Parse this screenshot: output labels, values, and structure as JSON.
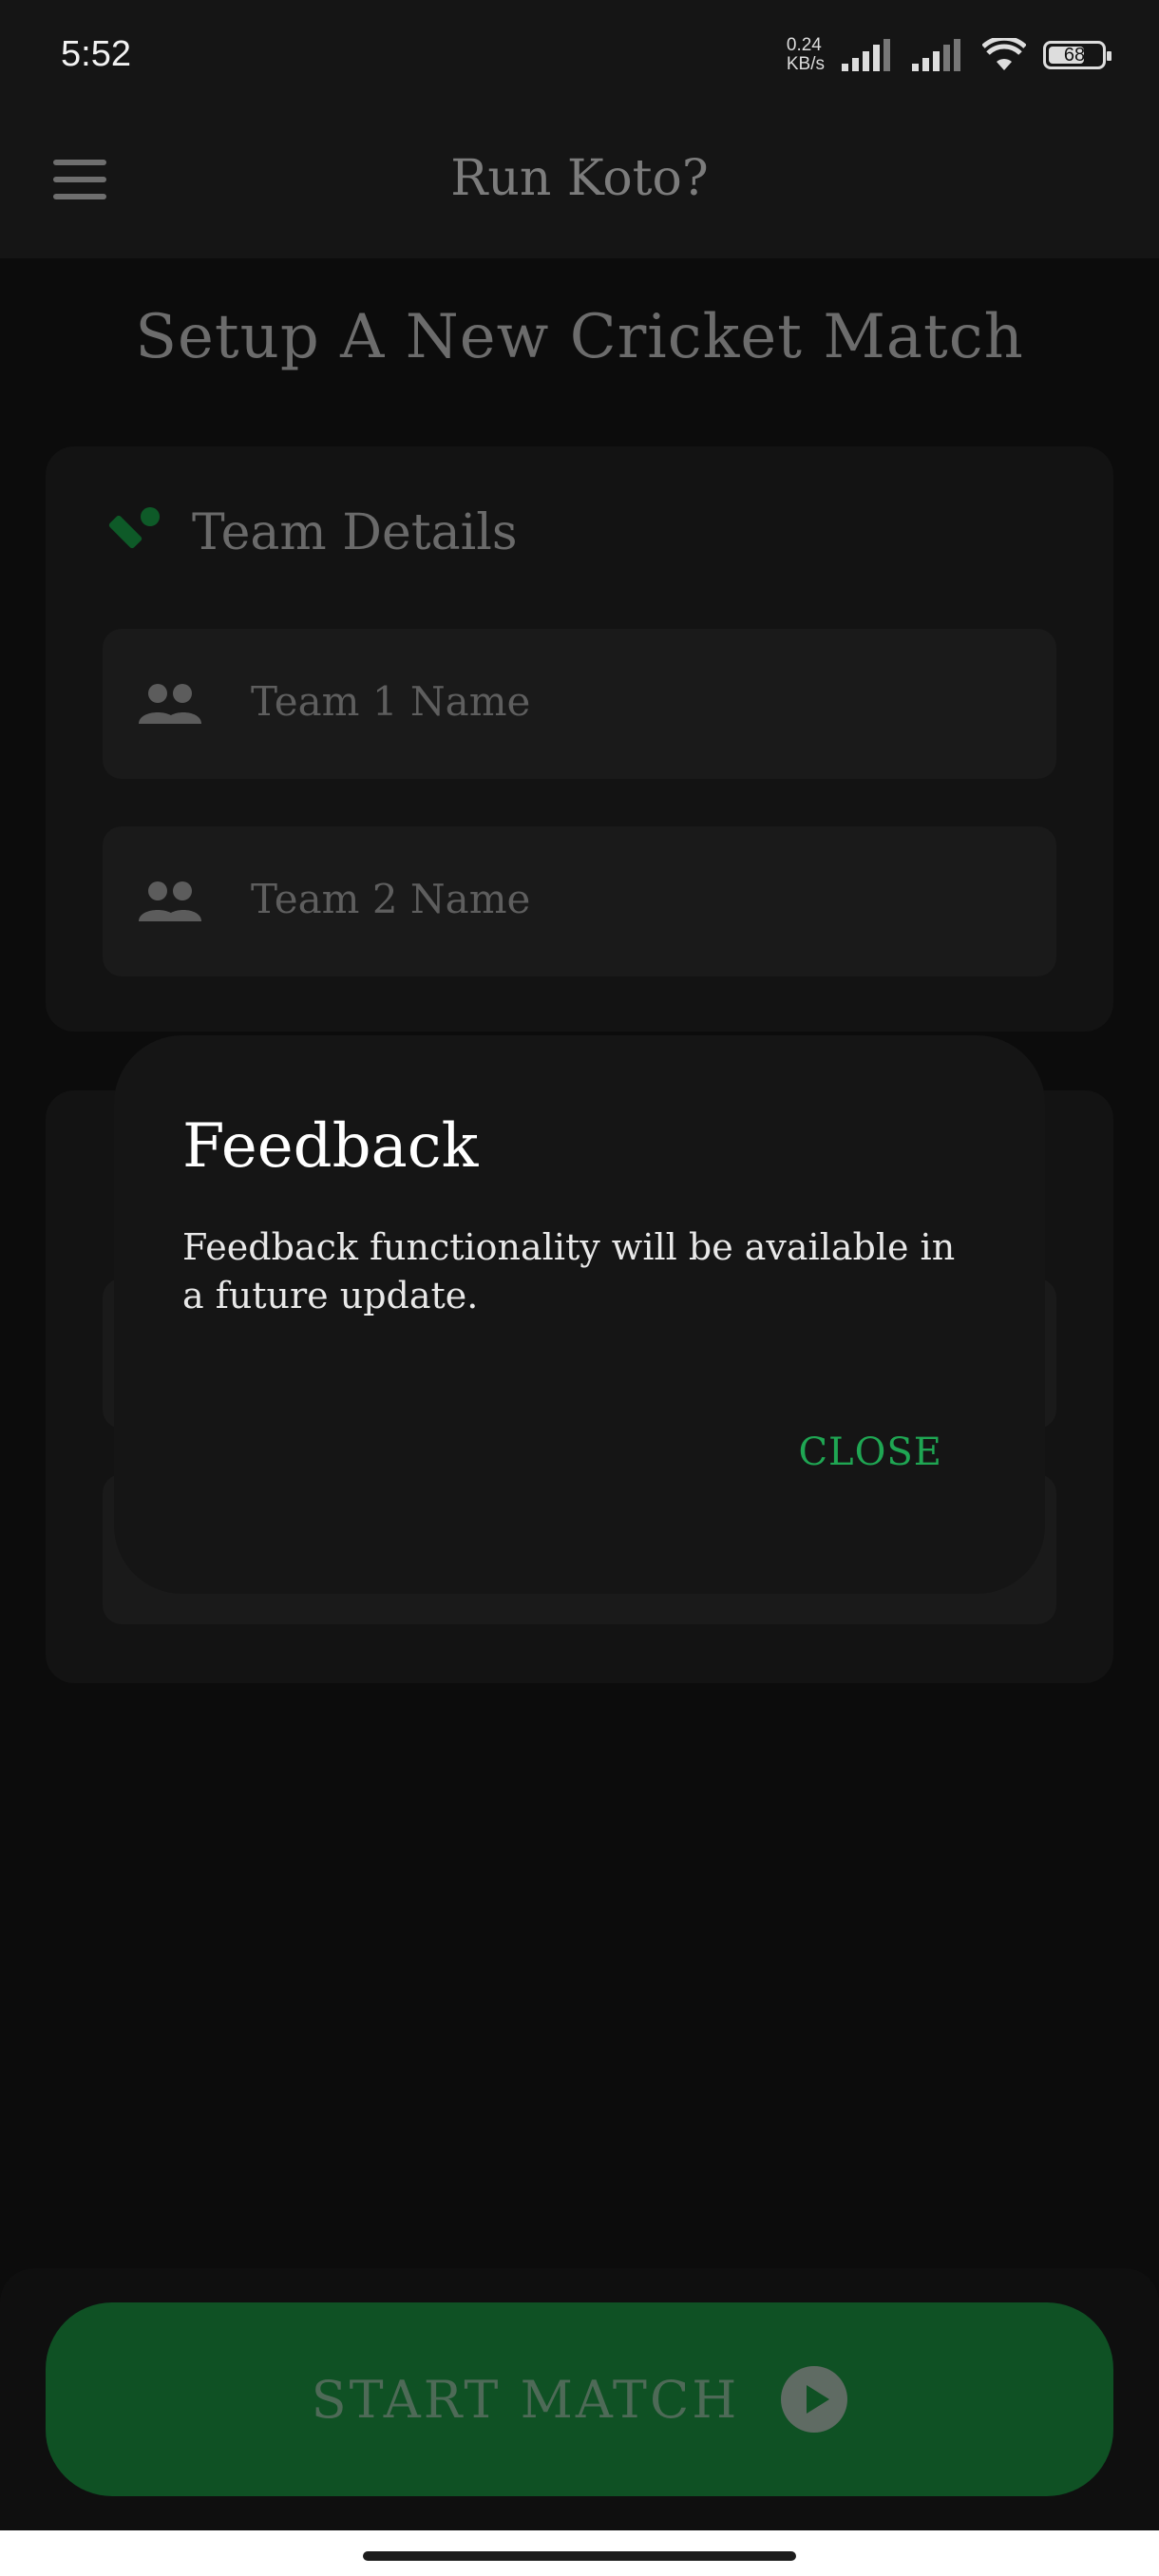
{
  "status_bar": {
    "time": "5:52",
    "net_speed_value": "0.24",
    "net_speed_unit": "KB/s",
    "battery": "68"
  },
  "app_bar": {
    "title": "Run Koto?",
    "menu_icon": "hamburger-menu-icon"
  },
  "page": {
    "title": "Setup A New Cricket Match"
  },
  "team_details": {
    "title": "Team Details",
    "icon": "cricket-bat-icon",
    "team1_placeholder": "Team 1 Name",
    "team2_placeholder": "Team 2 Name",
    "input_icon": "people-icon"
  },
  "dialog": {
    "title": "Feedback",
    "message": "Feedback functionality will be available in a future update.",
    "close_label": "CLOSE"
  },
  "footer": {
    "start_label": "START MATCH",
    "start_icon": "play-circle-icon"
  },
  "colors": {
    "accent_green": "#1fa653",
    "button_green": "#0f5124",
    "background": "#0d0d0d"
  }
}
